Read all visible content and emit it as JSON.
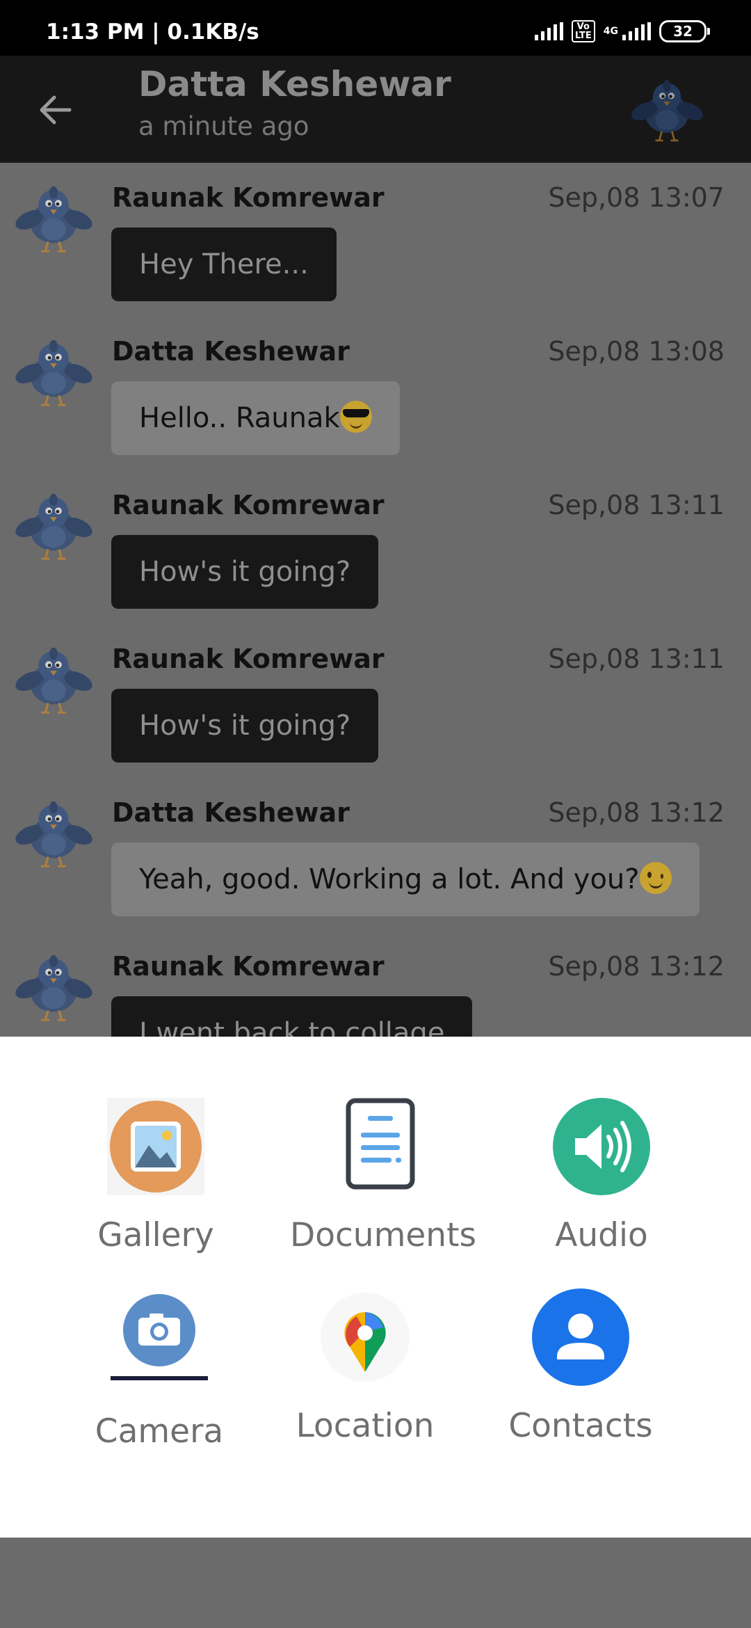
{
  "status_bar": {
    "time": "1:13 PM | 0.1KB/s",
    "battery": "32",
    "volte": "Vo\nLTE",
    "network": "4G"
  },
  "header": {
    "contact_name": "Datta Keshewar",
    "last_seen": "a minute ago"
  },
  "messages": [
    {
      "sender": "Raunak Komrewar",
      "time": "Sep,08  13:07",
      "text": "Hey There...",
      "emoji": "",
      "style": "dark"
    },
    {
      "sender": "Datta Keshewar",
      "time": "Sep,08  13:08",
      "text": "Hello.. Raunak",
      "emoji": "smiling-face-with-sunglasses",
      "style": "light"
    },
    {
      "sender": "Raunak Komrewar",
      "time": "Sep,08  13:11",
      "text": "How's it going?",
      "emoji": "",
      "style": "dark"
    },
    {
      "sender": "Raunak Komrewar",
      "time": "Sep,08  13:11",
      "text": "How's it going?",
      "emoji": "",
      "style": "dark"
    },
    {
      "sender": "Datta Keshewar",
      "time": "Sep,08  13:12",
      "text": "Yeah, good. Working a lot. And you?",
      "emoji": "winking-face",
      "style": "light"
    },
    {
      "sender": "Raunak Komrewar",
      "time": "Sep,08  13:12",
      "text": "I went back to collage",
      "emoji": "",
      "style": "dark"
    }
  ],
  "attachment_sheet": {
    "options": [
      {
        "label": "Gallery",
        "icon": "gallery-icon"
      },
      {
        "label": "Documents",
        "icon": "document-icon"
      },
      {
        "label": "Audio",
        "icon": "audio-icon"
      },
      {
        "label": "Camera",
        "icon": "camera-icon"
      },
      {
        "label": "Location",
        "icon": "location-pin-icon"
      },
      {
        "label": "Contacts",
        "icon": "contact-icon"
      }
    ]
  },
  "colors": {
    "audio": "#2fb38f",
    "contacts": "#1a73e8",
    "camera": "#5b8ec9",
    "gallery": "#e39a5a",
    "dim_overlay": "#6b6b6b"
  }
}
